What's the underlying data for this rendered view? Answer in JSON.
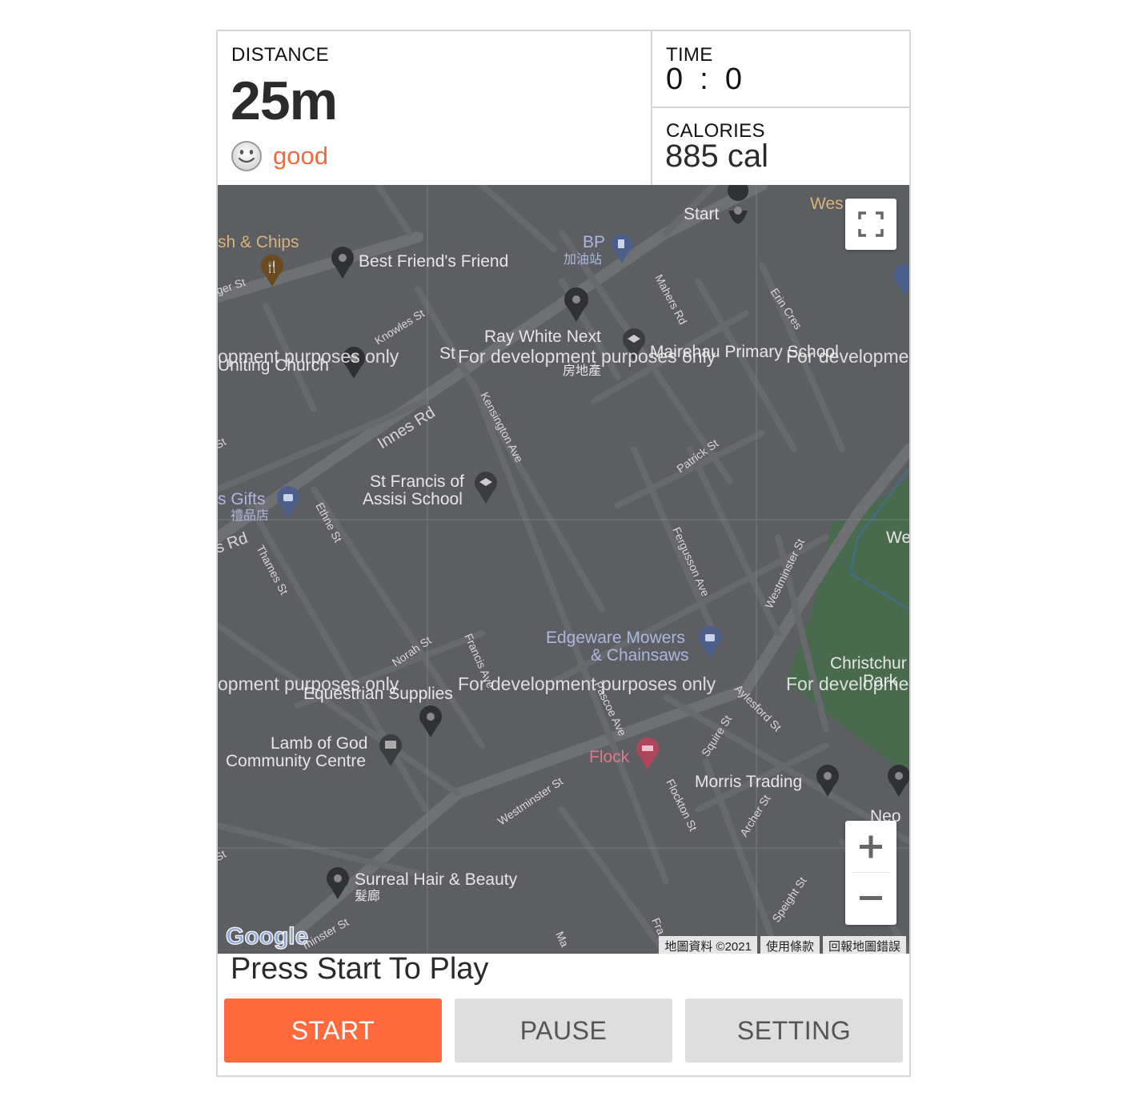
{
  "stats": {
    "distance_label": "DISTANCE",
    "distance_value": "25m",
    "mood_icon": "smiley-face-icon",
    "mood_text": "good",
    "time_label": "TIME",
    "time_value": "0  :  0",
    "calories_label": "CALORIES",
    "calories_value": "885 cal"
  },
  "map": {
    "watermark": "For development purposes only",
    "watermark_partial_left": "opment purposes only",
    "watermark_partial_right": "For developme",
    "places": {
      "fish_chips": "sh & Chips",
      "best_friends_friend": "Best Friend's Friend",
      "bp": "BP",
      "bp_sub": "加油站",
      "start": "Start",
      "westfield": "Wes",
      "ray_white": "Ray White Next",
      "ray_white_sub": "房地產",
      "ray_white_partial": "St",
      "mairehau": "Mairehau Primary School",
      "uniting_church": "Uniting Church",
      "st_francis_1": "St Francis of",
      "st_francis_2": "Assisi School",
      "gifts": "s Gifts",
      "gifts_sub": "禮品店",
      "edgeware_1": "Edgeware Mowers",
      "edgeware_2": "& Chainsaws",
      "equestrian": "Equestrian Supplies",
      "lamb_1": "Lamb of God",
      "lamb_2": "Community Centre",
      "flock": "Flock",
      "morris": "Morris Trading",
      "neo": "Neo",
      "christchurch_1": "Christchur",
      "christchurch_2": "Park",
      "we": "We",
      "surreal": "Surreal Hair & Beauty",
      "surreal_sub": "髮廊"
    },
    "streets": {
      "innes": "Innes Rd",
      "knowles": "Knowles St",
      "kensington": "Kensington Ave",
      "patrick": "Patrick St",
      "mahers": "Mahers Rd",
      "erin": "Erin Cres",
      "ethne": "Ethne St",
      "thames": "Thames St",
      "ferguson": "Fergusson Ave",
      "westminster_1": "Westminster St",
      "westminster_2": "Westminster St",
      "westminster_3": "minster St",
      "norah": "Norah St",
      "francis": "Francis Ave",
      "pascoe": "Pascoe Ave",
      "aylesford": "Aylesford St",
      "squire": "Squire St",
      "flockton": "Flockton St",
      "archer": "Archer St",
      "speight": "Speight St",
      "roger": "ger St",
      "rd_left": "s Rd",
      "st_left_1": "St",
      "st_left_2": "St",
      "ma": "Ma",
      "fra": "Fra"
    },
    "footer": {
      "data": "地圖資料 ©2021",
      "terms": "使用條款",
      "report": "回報地圖錯誤"
    },
    "logo_text": "Google",
    "fullscreen_icon": "fullscreen-icon",
    "zoom_in_icon": "plus-icon",
    "zoom_out_icon": "minus-icon",
    "colors": {
      "map_bg": "#5c5e62",
      "road": "#6f7175",
      "park": "#4a6a4e",
      "label": "#e8e8e8",
      "watermark": "#f2f2f2"
    }
  },
  "status_text": "Press Start To Play",
  "controls": {
    "start_label": "START",
    "pause_label": "PAUSE",
    "setting_label": "SETTING"
  },
  "colors": {
    "accent": "#ff6a3d",
    "mood": "#f26a3b",
    "button_gray": "#dedede"
  }
}
